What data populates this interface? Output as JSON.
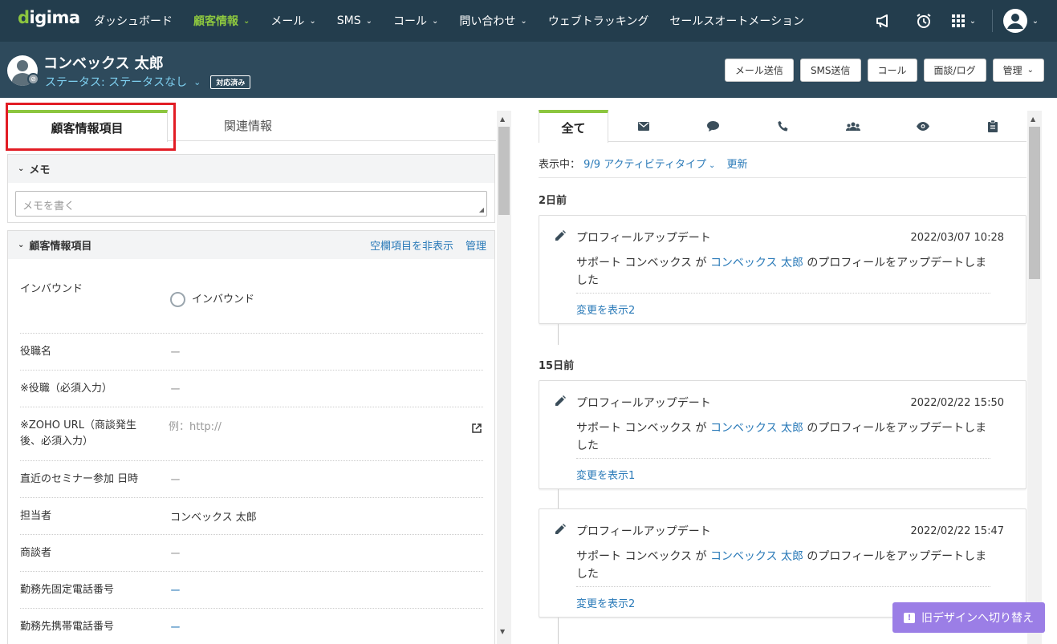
{
  "brand": {
    "logo": "digima"
  },
  "nav": {
    "items": [
      {
        "label": "ダッシュボード",
        "caret": false,
        "active": false
      },
      {
        "label": "顧客情報",
        "caret": true,
        "active": true
      },
      {
        "label": "メール",
        "caret": true,
        "active": false
      },
      {
        "label": "SMS",
        "caret": true,
        "active": false
      },
      {
        "label": "コール",
        "caret": true,
        "active": false
      },
      {
        "label": "問い合わせ",
        "caret": true,
        "active": false
      },
      {
        "label": "ウェブトラッキング",
        "caret": false,
        "active": false
      },
      {
        "label": "セールスオートメーション",
        "caret": false,
        "active": false
      }
    ],
    "icons": [
      "megaphone-icon",
      "alarm-icon",
      "apps-grid-icon",
      "user-avatar-icon"
    ]
  },
  "header": {
    "name": "コンベックス 太郎",
    "status": "ステータス: ステータスなし",
    "tag": "対応済み",
    "buttons": {
      "mail": "メール送信",
      "sms": "SMS送信",
      "call": "コール",
      "log": "面談/ログ",
      "manage": "管理"
    }
  },
  "left": {
    "tabs": {
      "active": "顧客情報項目",
      "other": "関連情報"
    },
    "memo": {
      "title": "メモ",
      "placeholder": "メモを書く"
    },
    "customer": {
      "title": "顧客情報項目",
      "hide_empty": "空欄項目を非表示",
      "manage": "管理",
      "fields": [
        {
          "label": "インバウンド",
          "value": "インバウンド"
        },
        {
          "label": "役職名",
          "value": "ー"
        },
        {
          "label": "※役職（必須入力）",
          "value": "ー"
        },
        {
          "label": "※ZOHO URL（商談発生後、必須入力）",
          "value": "例：http://"
        },
        {
          "label": "直近のセミナー参加 日時",
          "value": "ー"
        },
        {
          "label": "担当者",
          "value": "コンベックス 太郎"
        },
        {
          "label": "商談者",
          "value": "ー"
        },
        {
          "label": "勤務先固定電話番号",
          "value": "ー"
        },
        {
          "label": "勤務先携帯電話番号",
          "value": "ー"
        }
      ]
    }
  },
  "right": {
    "tabs": {
      "all": "全て"
    },
    "filter": {
      "label": "表示中：",
      "value": "9/9 アクティビティタイプ",
      "refresh": "更新"
    },
    "groups": [
      {
        "day": "2日前"
      },
      {
        "day": "15日前"
      }
    ],
    "cards": [
      {
        "title": "プロフィールアップデート",
        "time": "2022/03/07 10:28",
        "prefix": "サポート コンベックス が ",
        "link": "コンベックス 太郎",
        "suffix": " のプロフィールをアップデートしました",
        "more": "変更を表示2"
      },
      {
        "title": "プロフィールアップデート",
        "time": "2022/02/22 15:50",
        "prefix": "サポート コンベックス が ",
        "link": "コンベックス 太郎",
        "suffix": " のプロフィールをアップデートしました",
        "more": "変更を表示1"
      },
      {
        "title": "プロフィールアップデート",
        "time": "2022/02/22 15:47",
        "prefix": "サポート コンベックス が ",
        "link": "コンベックス 太郎",
        "suffix": " のプロフィールをアップデートしました",
        "more": "変更を表示2"
      }
    ]
  },
  "switch_design": "旧デザインへ切り替え",
  "colors": {
    "nav_bg": "#233d4d",
    "header_bg": "#2e4a5c",
    "accent": "#8cc63f",
    "link": "#2a7ab8",
    "highlight": "#e21d25",
    "switch": "#9b7ee6"
  }
}
